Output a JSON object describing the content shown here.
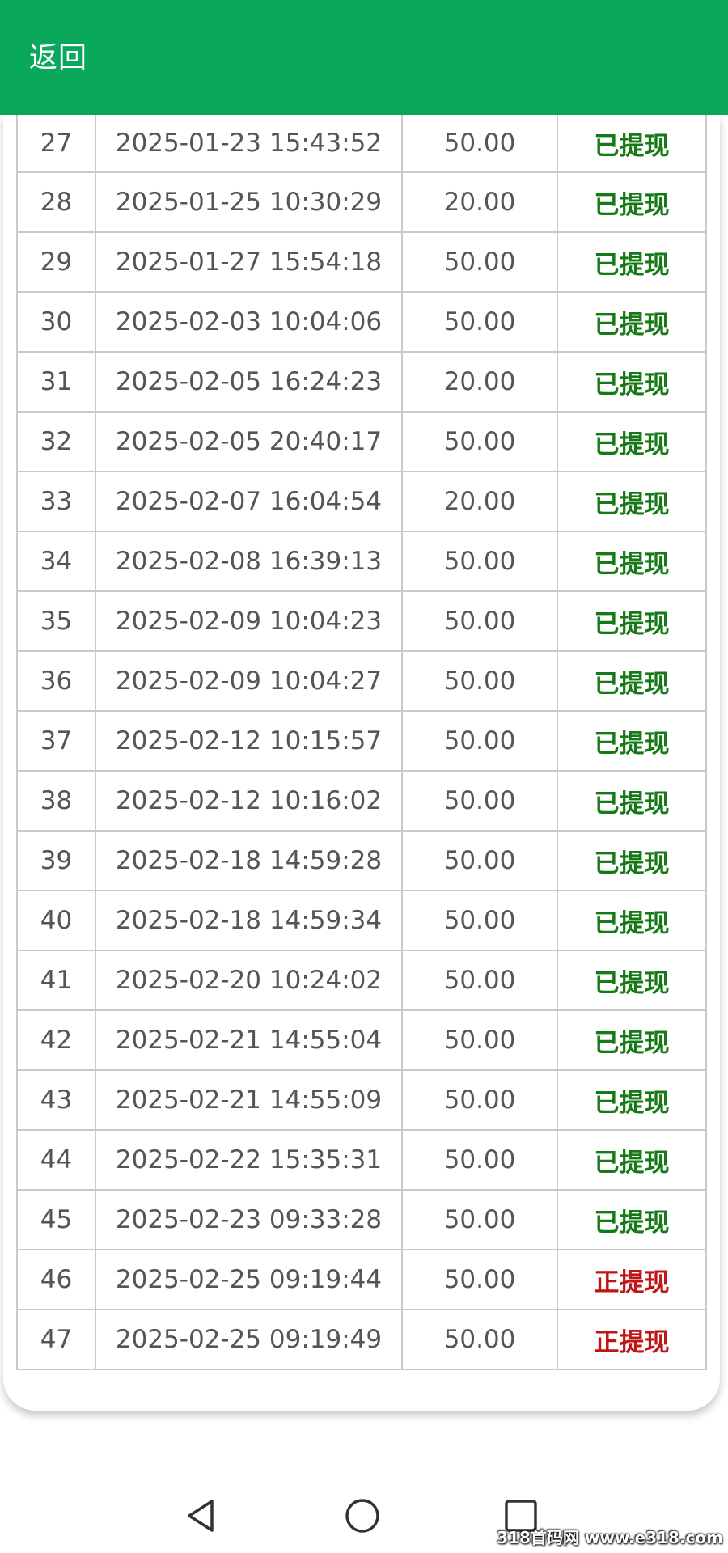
{
  "header": {
    "back_label": "返回",
    "color": "#0aa85a"
  },
  "colors": {
    "status_done": "#157a15",
    "status_pending": "#c01515"
  },
  "records": [
    {
      "index": "27",
      "time": "2025-01-23 15:43:52",
      "amount": "50.00",
      "status": "已提现",
      "state": "done"
    },
    {
      "index": "28",
      "time": "2025-01-25 10:30:29",
      "amount": "20.00",
      "status": "已提现",
      "state": "done"
    },
    {
      "index": "29",
      "time": "2025-01-27 15:54:18",
      "amount": "50.00",
      "status": "已提现",
      "state": "done"
    },
    {
      "index": "30",
      "time": "2025-02-03 10:04:06",
      "amount": "50.00",
      "status": "已提现",
      "state": "done"
    },
    {
      "index": "31",
      "time": "2025-02-05 16:24:23",
      "amount": "20.00",
      "status": "已提现",
      "state": "done"
    },
    {
      "index": "32",
      "time": "2025-02-05 20:40:17",
      "amount": "50.00",
      "status": "已提现",
      "state": "done"
    },
    {
      "index": "33",
      "time": "2025-02-07 16:04:54",
      "amount": "20.00",
      "status": "已提现",
      "state": "done"
    },
    {
      "index": "34",
      "time": "2025-02-08 16:39:13",
      "amount": "50.00",
      "status": "已提现",
      "state": "done"
    },
    {
      "index": "35",
      "time": "2025-02-09 10:04:23",
      "amount": "50.00",
      "status": "已提现",
      "state": "done"
    },
    {
      "index": "36",
      "time": "2025-02-09 10:04:27",
      "amount": "50.00",
      "status": "已提现",
      "state": "done"
    },
    {
      "index": "37",
      "time": "2025-02-12 10:15:57",
      "amount": "50.00",
      "status": "已提现",
      "state": "done"
    },
    {
      "index": "38",
      "time": "2025-02-12 10:16:02",
      "amount": "50.00",
      "status": "已提现",
      "state": "done"
    },
    {
      "index": "39",
      "time": "2025-02-18 14:59:28",
      "amount": "50.00",
      "status": "已提现",
      "state": "done"
    },
    {
      "index": "40",
      "time": "2025-02-18 14:59:34",
      "amount": "50.00",
      "status": "已提现",
      "state": "done"
    },
    {
      "index": "41",
      "time": "2025-02-20 10:24:02",
      "amount": "50.00",
      "status": "已提现",
      "state": "done"
    },
    {
      "index": "42",
      "time": "2025-02-21 14:55:04",
      "amount": "50.00",
      "status": "已提现",
      "state": "done"
    },
    {
      "index": "43",
      "time": "2025-02-21 14:55:09",
      "amount": "50.00",
      "status": "已提现",
      "state": "done"
    },
    {
      "index": "44",
      "time": "2025-02-22 15:35:31",
      "amount": "50.00",
      "status": "已提现",
      "state": "done"
    },
    {
      "index": "45",
      "time": "2025-02-23 09:33:28",
      "amount": "50.00",
      "status": "已提现",
      "state": "done"
    },
    {
      "index": "46",
      "time": "2025-02-25 09:19:44",
      "amount": "50.00",
      "status": "正提现",
      "state": "pending"
    },
    {
      "index": "47",
      "time": "2025-02-25 09:19:49",
      "amount": "50.00",
      "status": "正提现",
      "state": "pending"
    }
  ],
  "nav": {
    "back_icon": "triangle-back-icon",
    "home_icon": "circle-home-icon",
    "recents_icon": "square-recents-icon"
  },
  "watermark": "318首码网 www.e318.com"
}
